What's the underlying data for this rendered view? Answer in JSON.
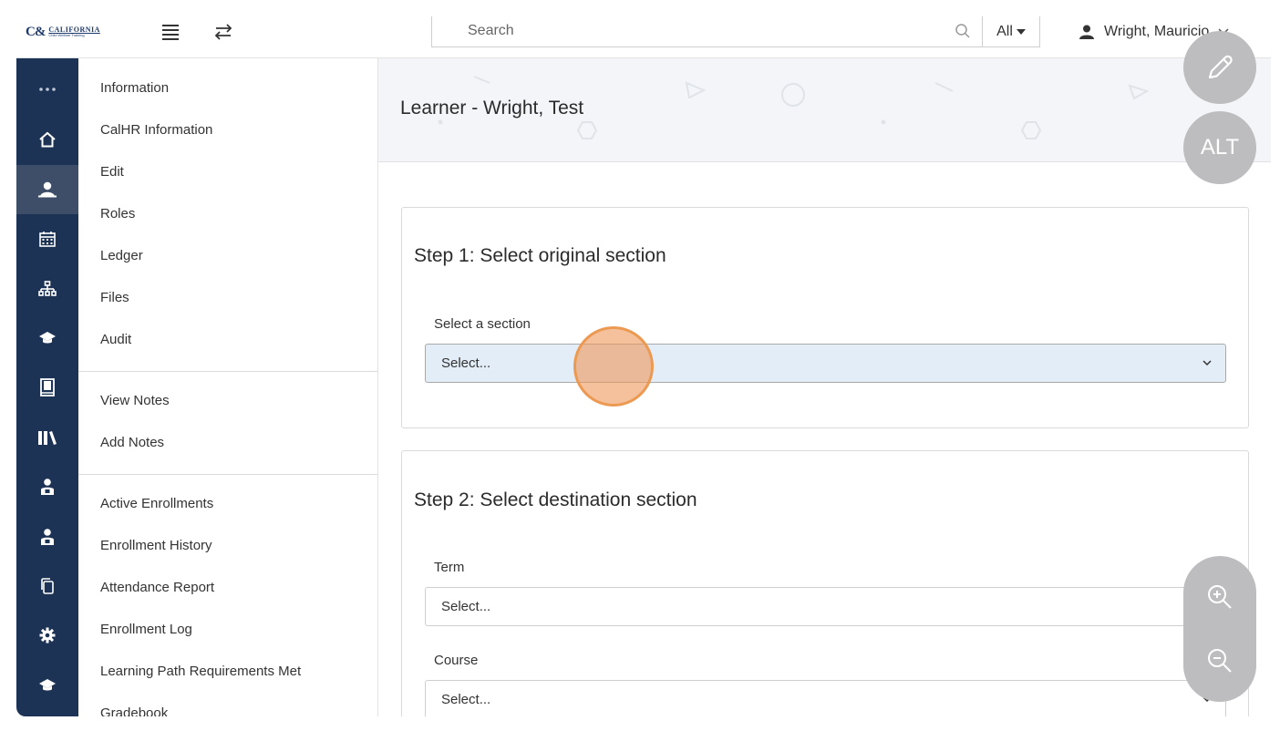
{
  "topbar": {
    "logo_text": "CALIFORNIA",
    "logo_subtext": "Child Welfare Training",
    "search_placeholder": "Search",
    "scope_label": "All",
    "user_name": "Wright, Mauricio"
  },
  "rail_icons": [
    "more-icon",
    "home-icon",
    "users-icon",
    "calendar-icon",
    "org-chart-icon",
    "graduation-cap-icon",
    "book-icon",
    "library-icon",
    "instructor-icon",
    "instructor-icon",
    "copy-icon",
    "gear-icon",
    "graduation-cap-icon"
  ],
  "subnav": {
    "group1": [
      "Information",
      "CalHR Information",
      "Edit",
      "Roles",
      "Ledger",
      "Files",
      "Audit"
    ],
    "group2": [
      "View Notes",
      "Add Notes"
    ],
    "group3": [
      "Active Enrollments",
      "Enrollment History",
      "Attendance Report",
      "Enrollment Log",
      "Learning Path Requirements Met",
      "Gradebook"
    ]
  },
  "page": {
    "title": "Learner - Wright, Test"
  },
  "step1": {
    "heading": "Step 1: Select original section",
    "section_label": "Select a section",
    "section_value": "Select..."
  },
  "step2": {
    "heading": "Step 2: Select destination section",
    "term_label": "Term",
    "term_value": "Select...",
    "course_label": "Course",
    "course_value": "Select..."
  },
  "fabs": {
    "alt_label": "ALT"
  }
}
